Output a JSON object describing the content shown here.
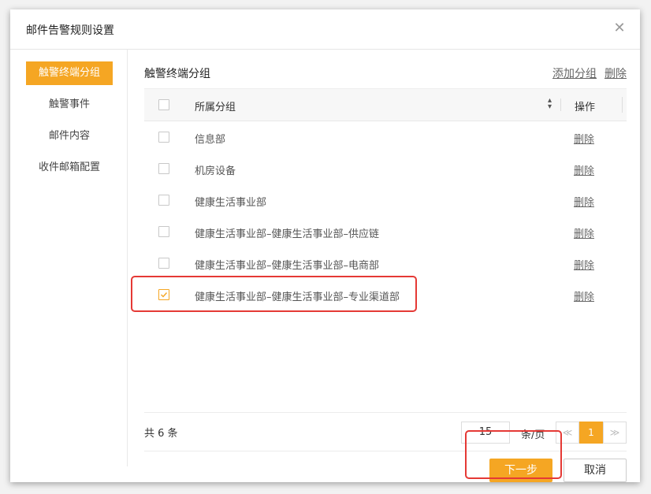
{
  "dialog": {
    "title": "邮件告警规则设置",
    "close_icon": "close-icon"
  },
  "sidebar": {
    "items": [
      {
        "label": "触警终端分组",
        "active": true
      },
      {
        "label": "触警事件",
        "active": false
      },
      {
        "label": "邮件内容",
        "active": false
      },
      {
        "label": "收件邮箱配置",
        "active": false
      }
    ]
  },
  "section": {
    "title": "触警终端分组",
    "add_link": "添加分组",
    "delete_link": "删除"
  },
  "table": {
    "headers": {
      "group": "所属分组",
      "action": "操作"
    },
    "rows": [
      {
        "group": "信息部",
        "action": "删除",
        "checked": false
      },
      {
        "group": "机房设备",
        "action": "删除",
        "checked": false
      },
      {
        "group": "健康生活事业部",
        "action": "删除",
        "checked": false
      },
      {
        "group": "健康生活事业部–健康生活事业部–供应链",
        "action": "删除",
        "checked": false
      },
      {
        "group": "健康生活事业部–健康生活事业部–电商部",
        "action": "删除",
        "checked": false
      },
      {
        "group": "健康生活事业部–健康生活事业部–专业渠道部",
        "action": "删除",
        "checked": true
      }
    ]
  },
  "pagination": {
    "total": "共 6 条",
    "page_size": "15",
    "per_page_label": "条/页",
    "prev": "≪",
    "current": "1",
    "next": "≫"
  },
  "buttons": {
    "next": "下一步",
    "cancel": "取消"
  },
  "colors": {
    "accent": "#f5a623",
    "highlight": "#e53935"
  }
}
